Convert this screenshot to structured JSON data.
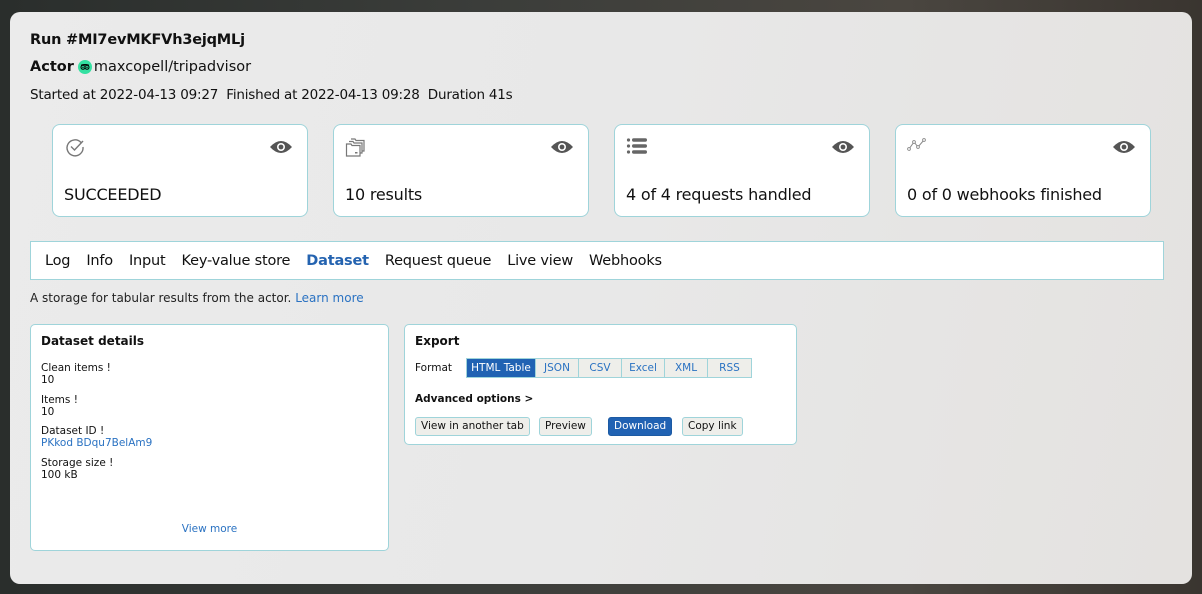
{
  "run": {
    "title": "Run #MI7evMKFVh3ejqMLj",
    "actor_label": "Actor",
    "actor_name": "maxcopell/tripadvisor",
    "actor_avatar_icon": "tripadvisor-owl-icon",
    "started_label": "Started at",
    "started_value": "2022-04-13 09:27",
    "finished_label": "Finished at",
    "finished_value": "2022-04-13 09:28",
    "duration_label": "Duration",
    "duration_value": "41s"
  },
  "cards": [
    {
      "icon": "check-circle-icon",
      "value": "SUCCEEDED",
      "action_icon": "eye-icon"
    },
    {
      "icon": "folders-icon",
      "value": "10 results",
      "action_icon": "eye-icon"
    },
    {
      "icon": "list-icon",
      "value": "4 of 4 requests handled",
      "action_icon": "eye-icon"
    },
    {
      "icon": "line-chart-icon",
      "value": "0 of 0 webhooks finished",
      "action_icon": "eye-icon"
    }
  ],
  "tabs": [
    {
      "label": "Log",
      "active": false
    },
    {
      "label": "Info",
      "active": false
    },
    {
      "label": "Input",
      "active": false
    },
    {
      "label": "Key-value store",
      "active": false
    },
    {
      "label": "Dataset",
      "active": true
    },
    {
      "label": "Request queue",
      "active": false
    },
    {
      "label": "Live view",
      "active": false
    },
    {
      "label": "Webhooks",
      "active": false
    }
  ],
  "description": {
    "text": "A storage for tabular results from the actor.",
    "link": "Learn more"
  },
  "dataset_details": {
    "title": "Dataset details",
    "rows": [
      {
        "label": "Clean items !",
        "value": "10"
      },
      {
        "label": "Items !",
        "value": "10"
      },
      {
        "label": "Dataset ID !",
        "value": "PKkod BDqu7BelAm9"
      },
      {
        "label": "Storage size !",
        "value": "100 kB"
      }
    ],
    "view_more": "View more"
  },
  "export": {
    "title": "Export",
    "format_label": "Format",
    "formats": [
      "HTML Table",
      "JSON",
      "CSV",
      "Excel",
      "XML",
      "RSS"
    ],
    "selected_format": "HTML Table",
    "advanced_options": "Advanced options >",
    "buttons": {
      "view_tab": "View in another tab",
      "preview": "Preview",
      "download": "Download",
      "copy_link": "Copy link"
    }
  },
  "colors": {
    "accent": "#2062b3",
    "link": "#2a72c2",
    "border": "#9fd4da",
    "actor_avatar": "#34e0a1"
  }
}
